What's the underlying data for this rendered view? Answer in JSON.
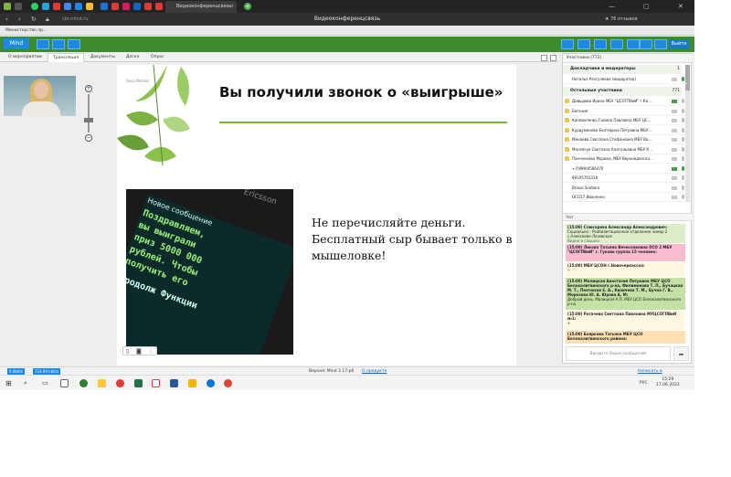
{
  "browser": {
    "tab_title": "Видеоконференцсвязь",
    "url": "cbr.mind.ru",
    "page_title": "Видеоконференцсвязь",
    "reviews_label": "★ 76 отзывов",
    "bookmark": "Министерство пр…"
  },
  "app": {
    "logo": "Mind",
    "exit_label": "Выйти"
  },
  "tabs": [
    {
      "label": "О мероприятии"
    },
    {
      "label": "Трансляция"
    },
    {
      "label": "Документы"
    },
    {
      "label": "Доска"
    },
    {
      "label": "Опрос"
    }
  ],
  "slide": {
    "brand": "Sova Mentor",
    "title": "Вы получили звонок о «выигрыше»",
    "phone_top": "Новое сообщение",
    "phone_brand": "Ericsson",
    "phone_lines": [
      "Поздравляем,",
      "вы выиграли",
      "приз 5000 000",
      "рублей. Чтобы",
      "получить его",
      "Продолж  Функции"
    ],
    "body": "Не перечисляйте деньги. Бесплатный сыр бывает только в мышеловке!"
  },
  "participants": {
    "header": "Участники (772)",
    "moderators_label": "Докладчики и модераторы",
    "moderators_count": "1",
    "moderator": "Наталья Разгуляева (модератор)",
    "others_label": "Остальные участники",
    "others_count": "771",
    "list": [
      {
        "name": "Давыдова Ирина МБУ \"ЦСОГПВиИ\" г.Ка…",
        "cam": true,
        "mic": false
      },
      {
        "name": "Евгения",
        "cam": false,
        "mic": false
      },
      {
        "name": "Кановаленко Галина Павловна МБУ ЦС…",
        "cam": false,
        "mic": false
      },
      {
        "name": "Курдуманова Екатерина Петровна МБУ…",
        "cam": false,
        "mic": false
      },
      {
        "name": "Минаева Светлана Стефановна МБУ Ва…",
        "cam": false,
        "mic": false
      },
      {
        "name": "Мосейчук Светлана Анатольевна МБУ К…",
        "cam": false,
        "mic": false
      },
      {
        "name": "Панченкова Марина, МБУ Верхнедонско…",
        "cam": false,
        "mic": false
      },
      {
        "name": "+7(999)4566470",
        "cam": true,
        "mic": true
      },
      {
        "name": "89105791318",
        "cam": false,
        "mic": false
      },
      {
        "name": "Briaus Snebara",
        "cam": false,
        "mic": false
      },
      {
        "name": "ОСО17 Иваненко",
        "cam": false,
        "mic": false
      }
    ]
  },
  "chat": {
    "header": "Чат",
    "messages": [
      {
        "author": "(15:00) Слюсарева Александр Александрович:",
        "text": "Социально - Реабилитационное отделение номер 2 с.Алексеево-Лозовское",
        "extra": "Видно и слышно",
        "color": "#dcedc8"
      },
      {
        "author": "(15:00) Лисова Татьяна Вячеславовна ОСО 2 МБУ \"ЦСОГПВиИ\" г. Гуково группа 15 человек:",
        "text": "",
        "extra": "",
        "color": "#f8bbd0"
      },
      {
        "author": "(15:00) МБУ ЦСОН г.Новочеркасска:",
        "text": "",
        "extra": "+",
        "color": "#fff8e1"
      },
      {
        "author": "(15:00) Малицкая Анастасия Петровна МБУ ЦСО Белокалитвинского р-на, Филимонова Т. П., Бучацкая М. Т., Пентюхов Е. А., Кваичева Т. М., Бучна Г. В., Морозова Ю. А. Юрова А. М:",
        "text": "Добрый день. Малицкая А.П. МБУ ЦСО Белокалитвинского р-на",
        "extra": "",
        "color": "#c5e1a5"
      },
      {
        "author": "(15:00) Рогачева Светлана Павловна МУЦСОГПВиИ №1:",
        "text": "+",
        "extra": "",
        "color": "#fff8e1"
      },
      {
        "author": "(15:00) Бояркова Татьяна МБУ ЦСО Белокалитвинского района:",
        "text": "",
        "extra": "",
        "color": "#ffe0b2"
      }
    ],
    "input_placeholder": "Введите Ваше сообщение"
  },
  "statusbar": {
    "left_chip1": "0.0bit/s",
    "left_chip2": "724.94 kbit/s",
    "version": "Версия: Mind 3.17-p6",
    "help": "О продукте",
    "support": "Написать в техподдержку"
  },
  "taskbar": {
    "lang": "РУС",
    "time": "15:29",
    "date": "17.06.2022"
  },
  "colors": {
    "app_green": "#3d8b2f",
    "accent_blue": "#1e88e5",
    "slide_green": "#7cb342"
  }
}
